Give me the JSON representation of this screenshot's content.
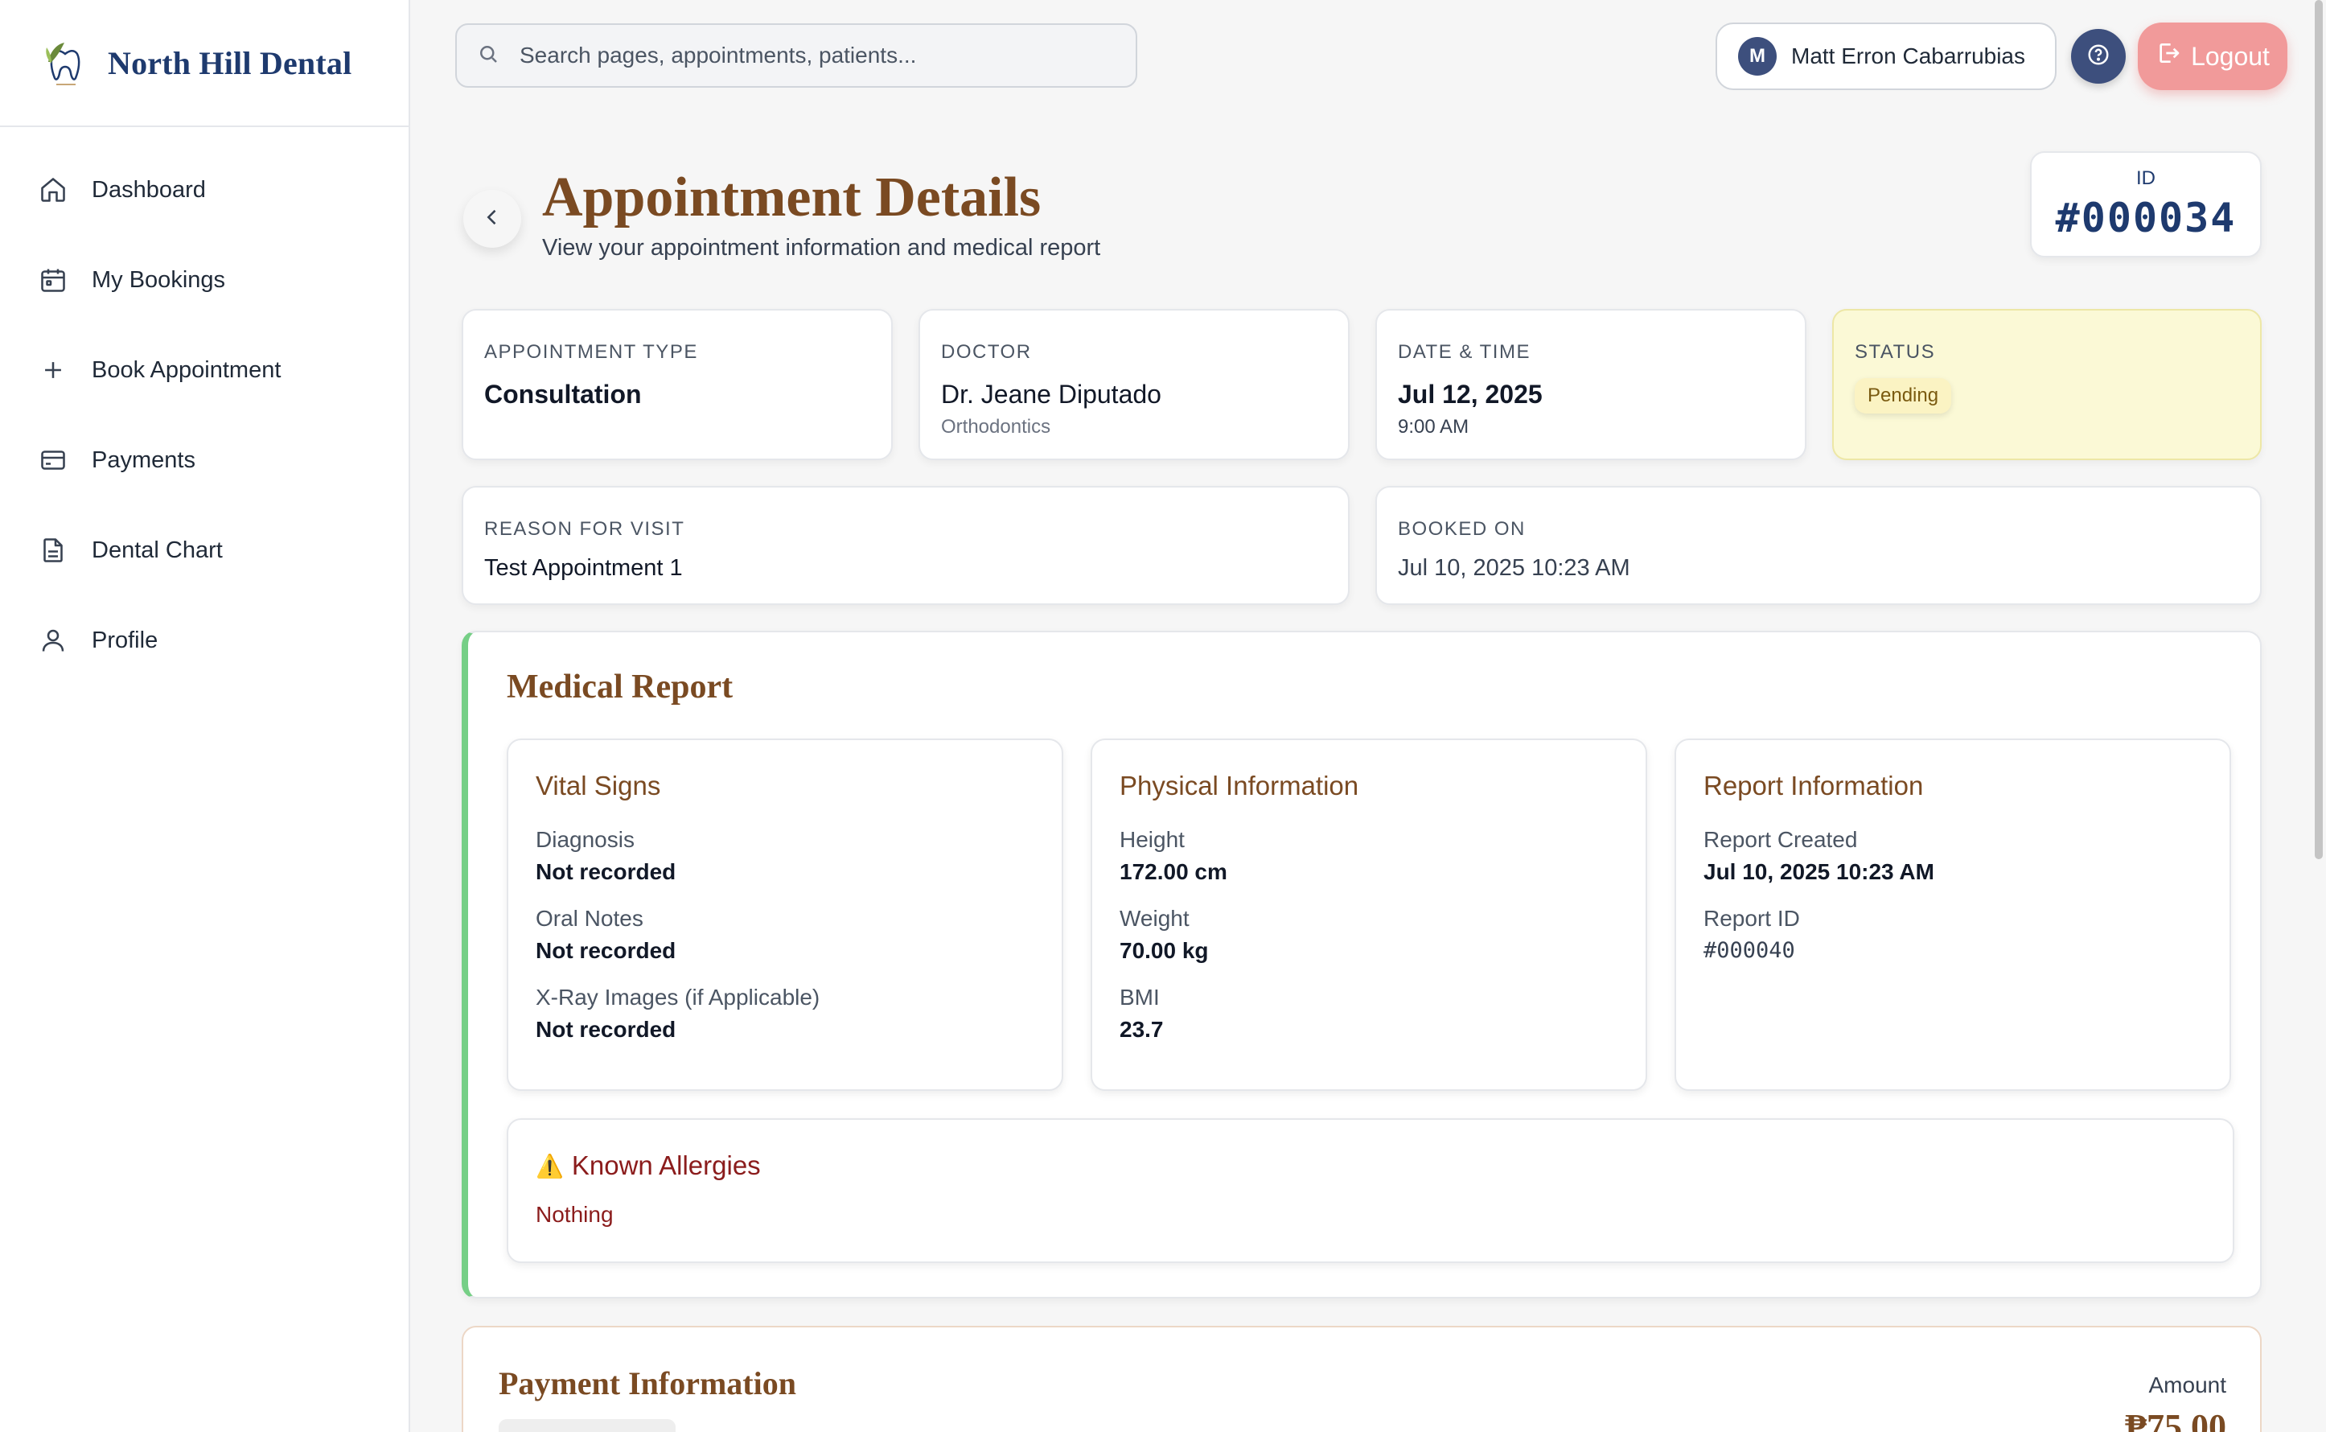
{
  "brand": {
    "name": "North Hill Dental",
    "logo_icon": "tooth-leaf-logo"
  },
  "sidebar": {
    "items": [
      {
        "label": "Dashboard",
        "icon": "home-icon"
      },
      {
        "label": "My Bookings",
        "icon": "calendar-icon"
      },
      {
        "label": "Book Appointment",
        "icon": "plus-icon"
      },
      {
        "label": "Payments",
        "icon": "credit-card-icon"
      },
      {
        "label": "Dental Chart",
        "icon": "document-icon"
      },
      {
        "label": "Profile",
        "icon": "user-icon"
      }
    ]
  },
  "topbar": {
    "search_placeholder": "Search pages, appointments, patients...",
    "user_initial": "M",
    "user_name": "Matt Erron Cabarrubias",
    "logout_label": "Logout"
  },
  "header": {
    "title": "Appointment Details",
    "subtitle": "View your appointment information and medical report",
    "id_label": "ID",
    "id_value": "#000034"
  },
  "appointment": {
    "type_label": "APPOINTMENT TYPE",
    "type_value": "Consultation",
    "doctor_label": "DOCTOR",
    "doctor_name": "Dr. Jeane Diputado",
    "doctor_specialty": "Orthodontics",
    "datetime_label": "DATE & TIME",
    "date": "Jul 12, 2025",
    "time": "9:00 AM",
    "status_label": "STATUS",
    "status_value": "Pending",
    "reason_label": "REASON FOR VISIT",
    "reason_value": "Test Appointment 1",
    "booked_label": "BOOKED ON",
    "booked_value": "Jul 10, 2025 10:23 AM"
  },
  "medical_report": {
    "title": "Medical Report",
    "vital_signs": {
      "title": "Vital Signs",
      "diagnosis_label": "Diagnosis",
      "diagnosis_value": "Not recorded",
      "oral_notes_label": "Oral Notes",
      "oral_notes_value": "Not recorded",
      "xray_label": "X-Ray Images (if Applicable)",
      "xray_value": "Not recorded"
    },
    "physical": {
      "title": "Physical Information",
      "height_label": "Height",
      "height_value": "172.00 cm",
      "weight_label": "Weight",
      "weight_value": "70.00 kg",
      "bmi_label": "BMI",
      "bmi_value": "23.7"
    },
    "report_info": {
      "title": "Report Information",
      "created_label": "Report Created",
      "created_value": "Jul 10, 2025 10:23 AM",
      "id_label": "Report ID",
      "id_value": "#000040"
    },
    "allergies": {
      "icon": "⚠️",
      "title": "Known Allergies",
      "value": "Nothing"
    }
  },
  "payment": {
    "title": "Payment Information",
    "amount_label": "Amount",
    "amount_value": "₱75.00"
  },
  "colors": {
    "brand_navy": "#1e3a6e",
    "heading_brown": "#7a4a22",
    "report_accent": "#76cf86",
    "logout": "#f19a9a",
    "pending_bg": "#fbf9d6",
    "allergy_red": "#8b1c1c"
  }
}
